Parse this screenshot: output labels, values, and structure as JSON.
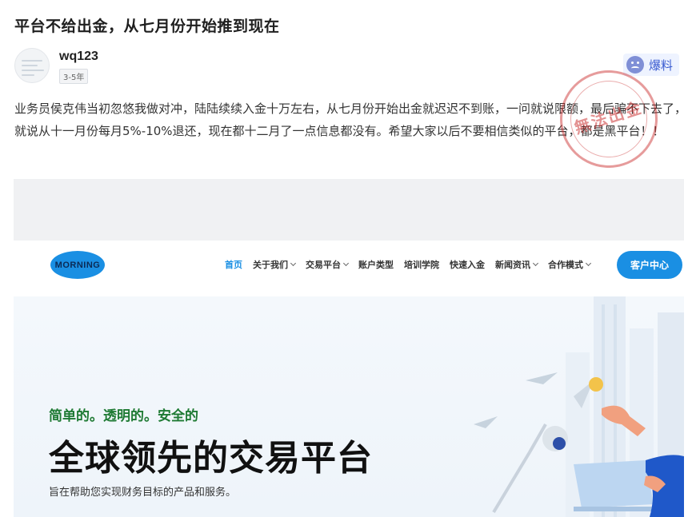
{
  "post": {
    "title": "平台不给出金，从七月份开始推到现在",
    "author": "wq123",
    "badge": "3-5年",
    "report_label": "爆料",
    "body": "业务员侯克伟当初忽悠我做对冲，陆陆续续入金十万左右，从七月份开始出金就迟迟不到账，一问就说限额，最后骗不下去了，就说从十一月份每月5%-10%退还，现在都十二月了一点信息都没有。希望大家以后不要相信类似的平台，都是黑平台！！",
    "stamp_text": "無法出金"
  },
  "site": {
    "logo": "MORNING",
    "nav": [
      {
        "label": "首页",
        "active": true,
        "dropdown": false
      },
      {
        "label": "关于我们",
        "active": false,
        "dropdown": true
      },
      {
        "label": "交易平台",
        "active": false,
        "dropdown": true
      },
      {
        "label": "账户类型",
        "active": false,
        "dropdown": false
      },
      {
        "label": "培训学院",
        "active": false,
        "dropdown": false
      },
      {
        "label": "快速入金",
        "active": false,
        "dropdown": false
      },
      {
        "label": "新闻资讯",
        "active": false,
        "dropdown": true
      },
      {
        "label": "合作模式",
        "active": false,
        "dropdown": true
      }
    ],
    "client_button": "客户中心",
    "hero_tag": "简单的。透明的。安全的",
    "hero_title": "全球领先的交易平台",
    "hero_subtitle": "旨在帮助您实现财务目标的产品和服务。"
  },
  "colors": {
    "accent": "#1a8fe3",
    "tag_green": "#1e7a33",
    "stamp_red": "#c82828",
    "report_blue": "#3a5bd0"
  }
}
